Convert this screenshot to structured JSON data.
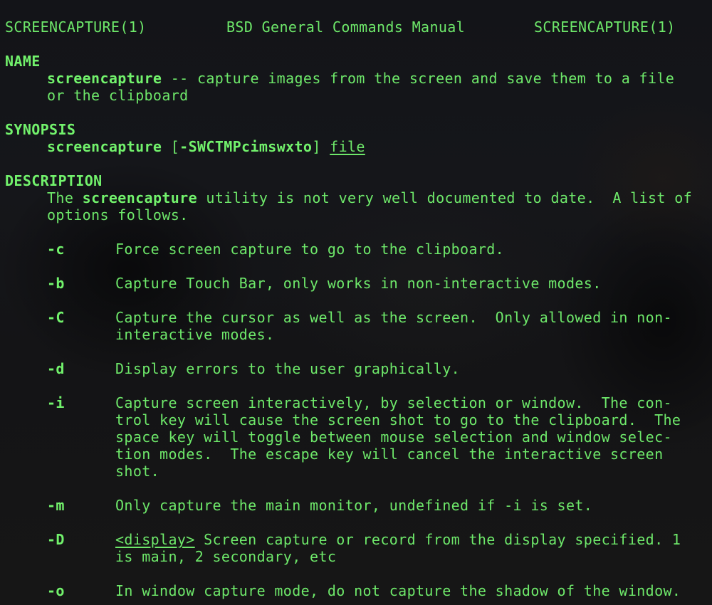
{
  "header": {
    "left": "SCREENCAPTURE(1)",
    "center": "BSD General Commands Manual",
    "right": "SCREENCAPTURE(1)"
  },
  "name_section": {
    "heading": "NAME",
    "command": "screencapture",
    "summary_line1": " -- capture images from the screen and save them to a file",
    "summary_line2": "or the clipboard"
  },
  "synopsis_section": {
    "heading": "SYNOPSIS",
    "command": "screencapture",
    "bracket_open": " [",
    "flags": "-SWCTMPcimswxto",
    "bracket_close": "] ",
    "argument": "file"
  },
  "description_section": {
    "heading": "DESCRIPTION",
    "intro_prefix": "The ",
    "intro_command": "screencapture",
    "intro_line1_rest": " utility is not very well documented to date.  A list of",
    "intro_line2": "options follows."
  },
  "options": [
    {
      "flag": "-c",
      "lines": [
        "Force screen capture to go to the clipboard."
      ]
    },
    {
      "flag": "-b",
      "lines": [
        "Capture Touch Bar, only works in non-interactive modes."
      ]
    },
    {
      "flag": "-C",
      "lines": [
        "Capture the cursor as well as the screen.  Only allowed in non-",
        "interactive modes."
      ]
    },
    {
      "flag": "-d",
      "lines": [
        "Display errors to the user graphically."
      ]
    },
    {
      "flag": "-i",
      "lines": [
        "Capture screen interactively, by selection or window.  The con-",
        "trol key will cause the screen shot to go to the clipboard.  The",
        "space key will toggle between mouse selection and window selec-",
        "tion modes.  The escape key will cancel the interactive screen",
        "shot."
      ]
    },
    {
      "flag": "-m",
      "lines": [
        "Only capture the main monitor, undefined if -i is set."
      ]
    },
    {
      "flag": "-D",
      "arg": "<display>",
      "lines": [
        " Screen capture or record from the display specified. 1",
        "is main, 2 secondary, etc"
      ]
    },
    {
      "flag": "-o",
      "lines": [
        "In window capture mode, do not capture the shadow of the window."
      ]
    }
  ],
  "colors": {
    "text": "#6ee86a",
    "bold_text": "#72f26c",
    "background": "#131416"
  }
}
